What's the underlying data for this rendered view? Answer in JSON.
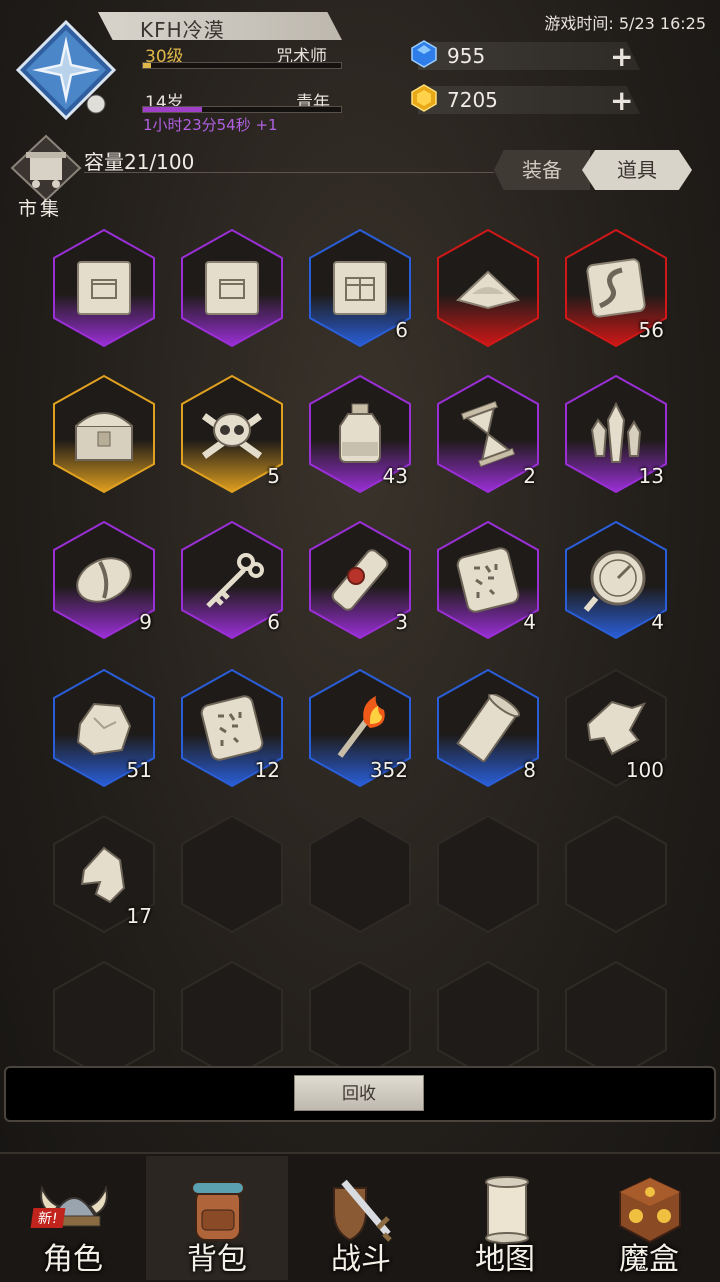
{
  "player": {
    "name": "KFH冷漠",
    "level": "30级",
    "class": "咒术师",
    "level_progress": 0.04,
    "age": "14岁",
    "stage": "青年",
    "age_progress": 0.3,
    "age_timer": "1小时23分54秒 +1"
  },
  "game_time": "游戏时间: 5/23 16:25",
  "currency": {
    "diamond": "955",
    "gold": "7205"
  },
  "market_label": "市集",
  "capacity": "容量21/100",
  "tabs": {
    "equipment": "装备",
    "items": "道具"
  },
  "items": [
    {
      "icon": "treasure-map-icon",
      "rarity": "purple",
      "count": ""
    },
    {
      "icon": "treasure-map-icon",
      "rarity": "purple",
      "count": ""
    },
    {
      "icon": "chest-map-icon",
      "rarity": "blue",
      "count": "6"
    },
    {
      "icon": "sand-pile-icon",
      "rarity": "red",
      "count": ""
    },
    {
      "icon": "rune-stone-icon",
      "rarity": "red",
      "count": "56"
    },
    {
      "icon": "treasure-chest-icon",
      "rarity": "gold",
      "count": ""
    },
    {
      "icon": "skull-crossbones-icon",
      "rarity": "gold",
      "count": "5"
    },
    {
      "icon": "sand-jar-icon",
      "rarity": "purple",
      "count": "43"
    },
    {
      "icon": "hourglass-icon",
      "rarity": "purple",
      "count": "2"
    },
    {
      "icon": "crystal-shards-icon",
      "rarity": "purple",
      "count": "13"
    },
    {
      "icon": "dragon-eye-icon",
      "rarity": "purple",
      "count": "9"
    },
    {
      "icon": "key-icon",
      "rarity": "purple",
      "count": "6"
    },
    {
      "icon": "sealed-scroll-icon",
      "rarity": "purple",
      "count": "3"
    },
    {
      "icon": "rune-tablet-icon",
      "rarity": "purple",
      "count": "4"
    },
    {
      "icon": "compass-icon",
      "rarity": "blue",
      "count": "4"
    },
    {
      "icon": "ore-rock-icon",
      "rarity": "blue",
      "count": "51"
    },
    {
      "icon": "rune-tablet-icon",
      "rarity": "blue",
      "count": "12"
    },
    {
      "icon": "torch-icon",
      "rarity": "blue",
      "count": "352"
    },
    {
      "icon": "scroll-icon",
      "rarity": "blue",
      "count": "8"
    },
    {
      "icon": "paper-fragment-icon",
      "rarity": "none",
      "count": "100"
    },
    {
      "icon": "bone-fragment-icon",
      "rarity": "none",
      "count": "17"
    },
    {
      "icon": "",
      "rarity": "empty",
      "count": ""
    },
    {
      "icon": "",
      "rarity": "empty",
      "count": ""
    },
    {
      "icon": "",
      "rarity": "empty",
      "count": ""
    },
    {
      "icon": "",
      "rarity": "empty",
      "count": ""
    },
    {
      "icon": "",
      "rarity": "empty",
      "count": ""
    },
    {
      "icon": "",
      "rarity": "empty",
      "count": ""
    },
    {
      "icon": "",
      "rarity": "empty",
      "count": ""
    },
    {
      "icon": "",
      "rarity": "empty",
      "count": ""
    },
    {
      "icon": "",
      "rarity": "empty",
      "count": ""
    }
  ],
  "rarity_colors": {
    "purple": "#9a2fd6",
    "blue": "#2a5ed8",
    "red": "#d01818",
    "gold": "#e0a020",
    "none": "#2a2622",
    "empty": "#2a2622"
  },
  "recycle_label": "回收",
  "nav": [
    {
      "label": "角色",
      "icon": "viking-helmet-icon",
      "badge": "新!"
    },
    {
      "label": "背包",
      "icon": "backpack-icon",
      "active": true
    },
    {
      "label": "战斗",
      "icon": "sword-shield-icon"
    },
    {
      "label": "地图",
      "icon": "map-scroll-icon"
    },
    {
      "label": "魔盒",
      "icon": "magic-box-icon"
    }
  ]
}
